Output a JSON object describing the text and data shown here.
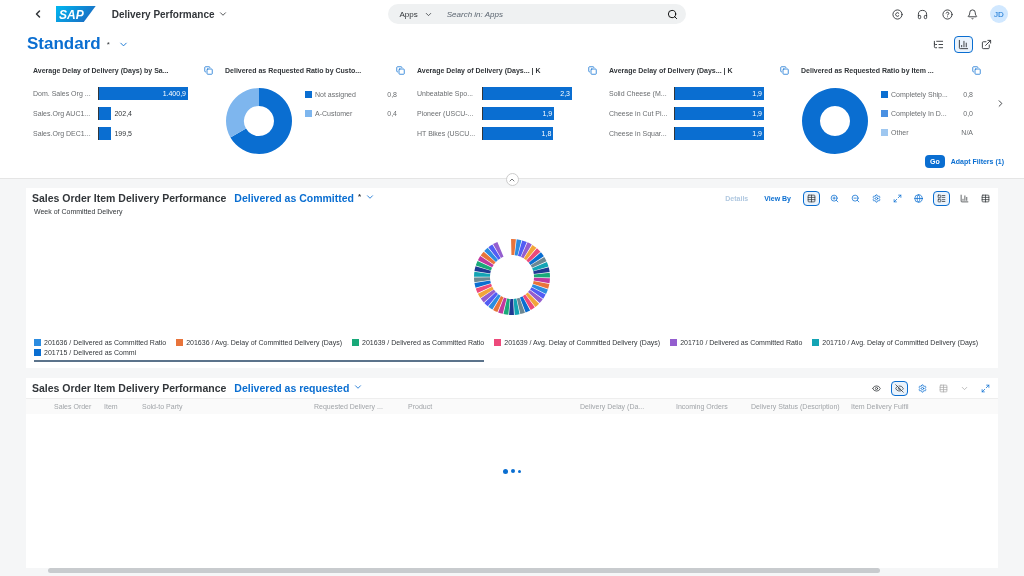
{
  "shell": {
    "logo": "SAP",
    "app_title": "Delivery Performance",
    "search": {
      "scope": "Apps",
      "placeholder": "Search in: Apps"
    },
    "avatar": "JD"
  },
  "header": {
    "variant": "Standard",
    "modified": "*"
  },
  "filter_cards": [
    {
      "kind": "bar",
      "title": "Average Delay of Delivery (Days) by Sa...",
      "rows": [
        {
          "label": "Dom. Sales Org ...",
          "value": "1.400,9",
          "level": 1
        },
        {
          "label": "Sales.Org AUC1...",
          "value": "202,4",
          "level": 0.14
        },
        {
          "label": "Sales.Org DEC1...",
          "value": "199,5",
          "level": 0.14
        }
      ]
    },
    {
      "kind": "donut",
      "title": "Delivered as Requested Ratio by Custo...",
      "legend": [
        {
          "label": "Not assigned",
          "value": "0,8",
          "color": "#0a6ed1"
        },
        {
          "label": "A-Customer",
          "value": "0,4",
          "color": "#7eb6ee"
        }
      ]
    },
    {
      "kind": "bar",
      "title": "Average Delay of Delivery (Days...  | K",
      "rows": [
        {
          "label": "Unbeatable Spo...",
          "value": "2,3",
          "level": 1
        },
        {
          "label": "Pioneer (USCU-...",
          "value": "1,9",
          "level": 0.8
        },
        {
          "label": "HT Bikes (USCU...",
          "value": "1,8",
          "level": 0.79
        }
      ]
    },
    {
      "kind": "bar",
      "title": "Average Delay of Delivery (Days...  | K",
      "rows": [
        {
          "label": "Solid Cheese (M...",
          "value": "1,9",
          "level": 1
        },
        {
          "label": "Cheese in Cut Pi...",
          "value": "1,9",
          "level": 1
        },
        {
          "label": "Cheese in Squar...",
          "value": "1,9",
          "level": 1
        }
      ]
    },
    {
      "kind": "donut",
      "title": "Delivered as Requested Ratio by Item ...",
      "legend": [
        {
          "label": "Completely Ship...",
          "value": "0,8",
          "color": "#0a6ed1"
        },
        {
          "label": "Completely In D...",
          "value": "0,0",
          "color": "#4a90e2"
        },
        {
          "label": "Other",
          "value": "N/A",
          "color": "#9ec7f0"
        }
      ]
    }
  ],
  "filter_actions": {
    "go": "Go",
    "adapt": "Adapt Filters (1)"
  },
  "chart_panel": {
    "title": "Sales Order Item Delivery Performance",
    "variant": "Delivered as Committed",
    "modified": "*",
    "toolbar": {
      "details": "Details",
      "details_disabled": true,
      "view_by": "View By"
    },
    "axis_label": "Week of Committed Delivery",
    "legend": [
      {
        "label": "201636 / Delivered as Committed Ratio",
        "color": "#2c8ce0"
      },
      {
        "label": "201636 / Avg. Delay of Committed Delivery (Days)",
        "color": "#e8743b"
      },
      {
        "label": "201639 / Delivered as Committed Ratio",
        "color": "#19a979"
      },
      {
        "label": "201639 / Avg. Delay of Committed Delivery (Days)",
        "color": "#ed4a7b"
      },
      {
        "label": "201710 / Delivered as Committed Ratio",
        "color": "#945ecf"
      },
      {
        "label": "201710 / Avg. Delay of Committed Delivery (Days)",
        "color": "#13a4b4"
      },
      {
        "label": "201715 / Delivered as Commi",
        "color": "#0a6ed1"
      }
    ]
  },
  "table_panel": {
    "title": "Sales Order Item Delivery Performance",
    "variant": "Delivered as requested",
    "columns": [
      "Sales Order",
      "Item",
      "Sold-to Party",
      "Requested Delivery ...",
      "Product",
      "Delivery Delay (Da...",
      "Incoming Orders",
      "Delivery Status (Description)",
      "Item Delivery Fulfil"
    ],
    "loading": true
  }
}
